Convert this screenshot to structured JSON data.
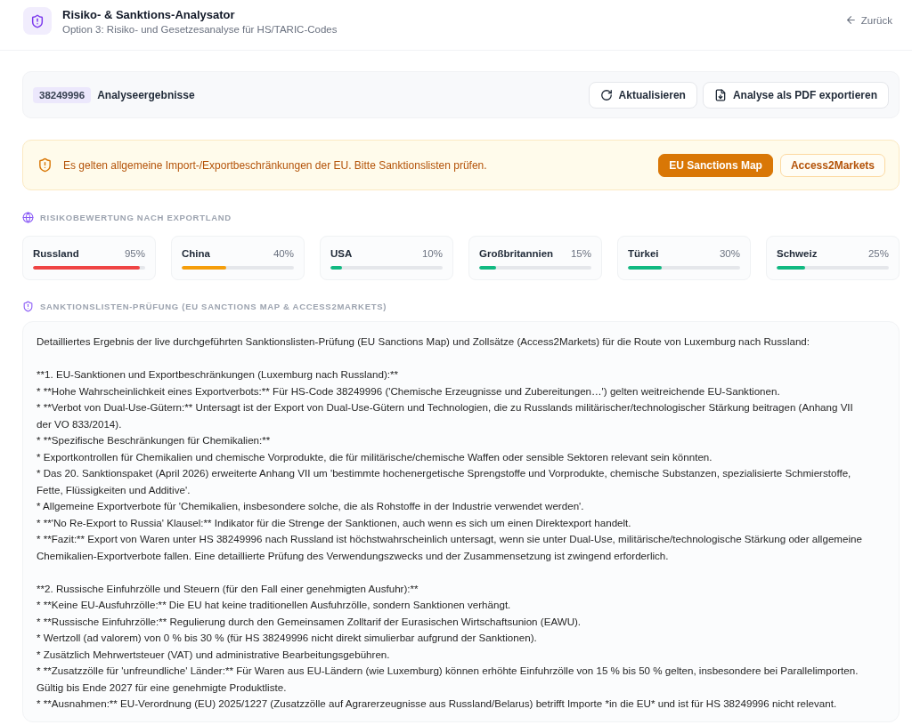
{
  "header": {
    "title": "Risiko- & Sanktions-Analysator",
    "subtitle": "Option 3: Risiko- und Gesetzesanalyse für HS/TARIC-Codes",
    "back_link": "Zurück"
  },
  "toolbar": {
    "code": "38249996",
    "title": "Analyseergebnisse",
    "buttons": [
      {
        "label": "Aktualisieren",
        "kind": "refresh"
      },
      {
        "label": "Analyse als PDF exportieren",
        "kind": "pdf"
      }
    ]
  },
  "alert": {
    "message": "Es gelten allgemeine Import-/Exportbeschränkungen der EU. Bitte Sanktionslisten prüfen.",
    "buttons": [
      {
        "label": "EU Sanctions Map",
        "kind": "primary"
      },
      {
        "label": "Access2Markets",
        "kind": "outline"
      }
    ]
  },
  "risk_section": {
    "heading": "RISIKOBEWERTUNG NACH EXPORTLAND",
    "countries": [
      {
        "name": "Russland",
        "reading": "95%",
        "level": 0.95,
        "color": "#ef4444"
      },
      {
        "name": "China",
        "reading": "40%",
        "level": 0.4,
        "color": "#f59e0b"
      },
      {
        "name": "USA",
        "reading": "10%",
        "level": 0.1,
        "color": "#10b981"
      },
      {
        "name": "Großbritannien",
        "reading": "15%",
        "level": 0.15,
        "color": "#10b981"
      },
      {
        "name": "Türkei",
        "reading": "30%",
        "level": 0.3,
        "color": "#10b981"
      },
      {
        "name": "Schweiz",
        "reading": "25%",
        "level": 0.25,
        "color": "#10b981"
      }
    ]
  },
  "sanctions_section": {
    "heading": "SANKTIONSLISTEN-PRÜFUNG (EU SANCTIONS MAP & ACCESS2MARKETS)",
    "blocks": [
      [
        "Detailliertes Ergebnis der live durchgeführten Sanktionslisten-Prüfung (EU Sanctions Map) und Zollsätze (Access2Markets) für die Route von Luxemburg nach Russland:"
      ],
      [
        "**1. EU-Sanktionen und Exportbeschränkungen (Luxemburg nach Russland):**",
        "* **Hohe Wahrscheinlichkeit eines Exportverbots:** Für HS-Code 38249996 ('Chemische Erzeugnisse und Zubereitungen…') gelten weitreichende EU-Sanktionen.",
        "* **Verbot von Dual-Use-Gütern:** Untersagt ist der Export von Dual-Use-Gütern und Technologien, die zu Russlands militärischer/technologischer Stärkung beitragen (Anhang VII der VO 833/2014).",
        "* **Spezifische Beschränkungen für Chemikalien:**",
        "* Exportkontrollen für Chemikalien und chemische Vorprodukte, die für militärische/chemische Waffen oder sensible Sektoren relevant sein könnten.",
        "* Das 20. Sanktionspaket (April 2026) erweiterte Anhang VII um 'bestimmte hochenergetische Sprengstoffe und Vorprodukte, chemische Substanzen, spezialisierte Schmierstoffe, Fette, Flüssigkeiten und Additive'.",
        "* Allgemeine Exportverbote für 'Chemikalien, insbesondere solche, die als Rohstoffe in der Industrie verwendet werden'.",
        "* **'No Re-Export to Russia' Klausel:** Indikator für die Strenge der Sanktionen, auch wenn es sich um einen Direktexport handelt.",
        "* **Fazit:** Export von Waren unter HS 38249996 nach Russland ist höchstwahrscheinlich untersagt, wenn sie unter Dual-Use, militärische/technologische Stärkung oder allgemeine Chemikalien-Exportverbote fallen. Eine detaillierte Prüfung des Verwendungszwecks und der Zusammensetzung ist zwingend erforderlich."
      ],
      [
        "**2. Russische Einfuhrzölle und Steuern (für den Fall einer genehmigten Ausfuhr):**",
        "* **Keine EU-Ausfuhrzölle:** Die EU hat keine traditionellen Ausfuhrzölle, sondern Sanktionen verhängt.",
        "* **Russische Einfuhrzölle:** Regulierung durch den Gemeinsamen Zolltarif der Eurasischen Wirtschaftsunion (EAWU).",
        "* Wertzoll (ad valorem) von 0 % bis 30 % (für HS 38249996 nicht direkt simulierbar aufgrund der Sanktionen).",
        "* Zusätzlich Mehrwertsteuer (VAT) und administrative Bearbeitungsgebühren.",
        "* **Zusatzzölle für 'unfreundliche' Länder:** Für Waren aus EU-Ländern (wie Luxemburg) können erhöhte Einfuhrzölle von 15 % bis 50 % gelten, insbesondere bei Parallelimporten. Gültig bis Ende 2027 für eine genehmigte Produktliste.",
        "* **Ausnahmen:** EU-Verordnung (EU) 2025/1227 (Zusatzzölle auf Agrarerzeugnisse aus Russland/Belarus) betrifft Importe *in die EU* und ist für HS 38249996 nicht relevant."
      ]
    ]
  }
}
